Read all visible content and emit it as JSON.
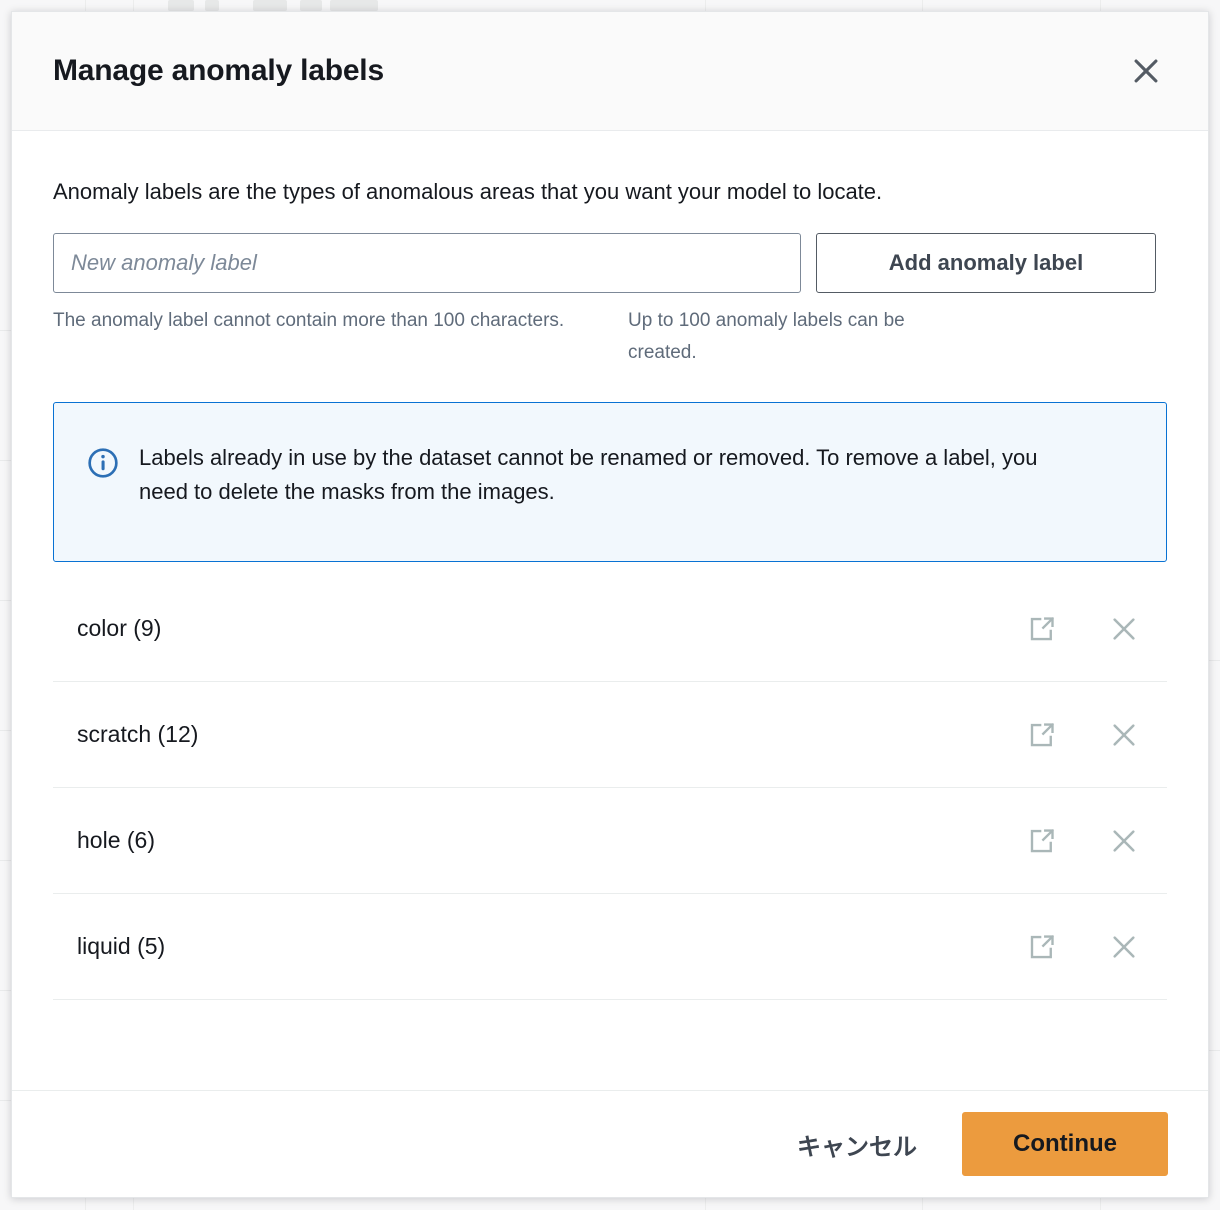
{
  "modal": {
    "title": "Manage anomaly labels",
    "close_icon": "close-icon",
    "intro": "Anomaly labels are the types of anomalous areas that you want your model to locate.",
    "form": {
      "input_placeholder": "New anomaly label",
      "input_value": "",
      "add_button_label": "Add anomaly label",
      "hint_left": "The anomaly label cannot contain more than 100 characters.",
      "hint_right": "Up to 100 anomaly labels can be created."
    },
    "alert": {
      "icon": "info-circle-icon",
      "text": "Labels already in use by the dataset cannot be renamed or removed. To remove a label, you need to delete the masks from the images.",
      "border_color": "#0972d3",
      "background_color": "#f2f8fd"
    },
    "labels": [
      {
        "name": "color (9)",
        "edit_icon": "edit-icon",
        "remove_icon": "close-icon"
      },
      {
        "name": "scratch (12)",
        "edit_icon": "edit-icon",
        "remove_icon": "close-icon"
      },
      {
        "name": "hole (6)",
        "edit_icon": "edit-icon",
        "remove_icon": "close-icon"
      },
      {
        "name": "liquid (5)",
        "edit_icon": "edit-icon",
        "remove_icon": "close-icon"
      }
    ],
    "footer": {
      "cancel_label": "キャンセル",
      "continue_label": "Continue",
      "continue_color": "#ec9b3e"
    }
  }
}
